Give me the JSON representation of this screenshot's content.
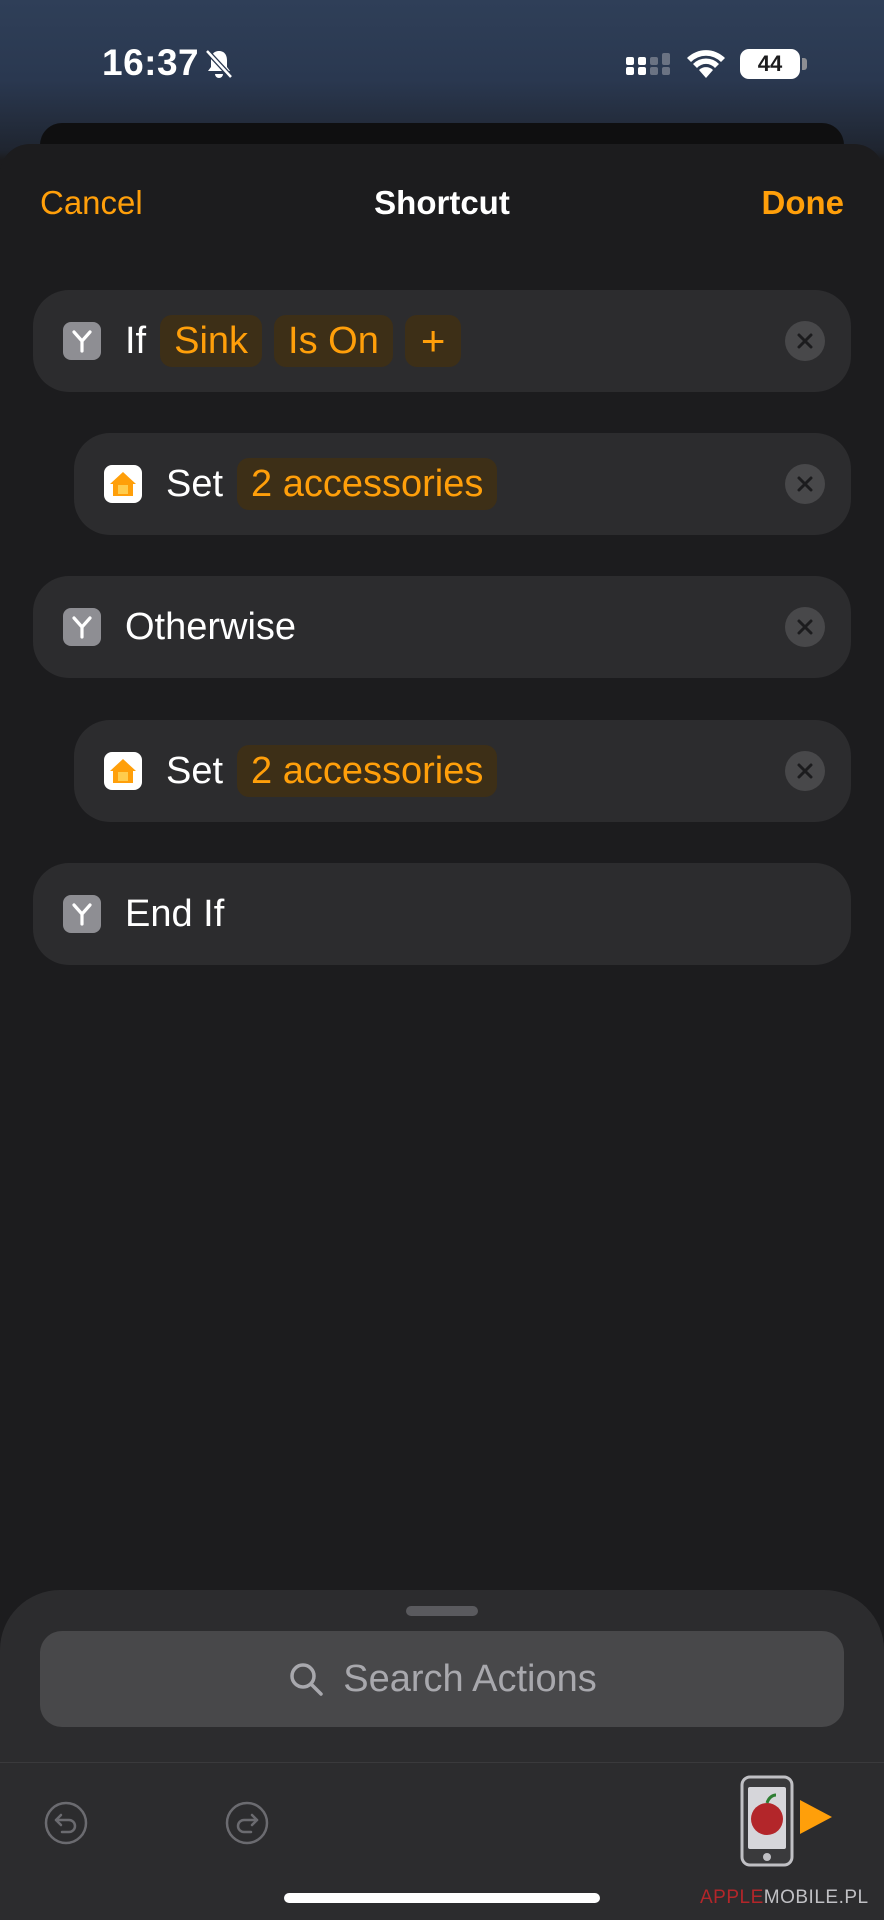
{
  "status_bar": {
    "time": "16:37",
    "battery": "44",
    "icons": [
      "bell-slash-icon",
      "cellular-signal-icon",
      "wifi-icon",
      "battery-icon"
    ]
  },
  "nav": {
    "cancel": "Cancel",
    "title": "Shortcut",
    "done": "Done"
  },
  "actions": [
    {
      "icon": "scripting-icon",
      "word": "If",
      "tokens": [
        "Sink",
        "Is On",
        "+"
      ],
      "removable": true
    },
    {
      "icon": "home-icon",
      "word": "Set",
      "tokens": [
        "2 accessories"
      ],
      "removable": true
    },
    {
      "icon": "scripting-icon",
      "word": "Otherwise",
      "tokens": [],
      "removable": true
    },
    {
      "icon": "home-icon",
      "word": "Set",
      "tokens": [
        "2 accessories"
      ],
      "removable": true
    },
    {
      "icon": "scripting-icon",
      "word": "End If",
      "tokens": [],
      "removable": false
    }
  ],
  "search": {
    "placeholder": "Search Actions"
  },
  "toolbar": {
    "icons": [
      "undo-icon",
      "redo-icon",
      "play-icon"
    ]
  },
  "watermark": {
    "part1": "APPLE",
    "part2": "MOBILE.PL"
  },
  "colors": {
    "accent": "#ff9f0a",
    "background": "#1c1c1e",
    "card": "#2c2c2e"
  }
}
